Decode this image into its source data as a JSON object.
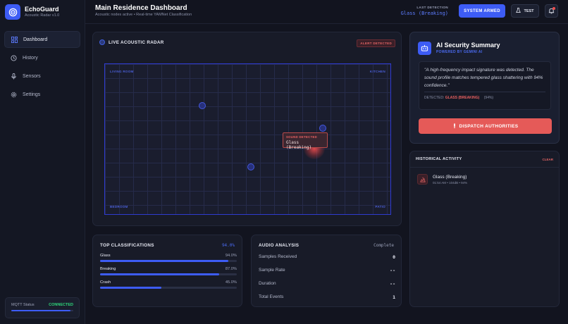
{
  "brand": {
    "name": "EchoGuard",
    "subtitle": "Acoustic Radar v1.0"
  },
  "nav": {
    "items": [
      {
        "label": "Dashboard",
        "icon": "grid-icon",
        "active": true
      },
      {
        "label": "History",
        "icon": "history-icon"
      },
      {
        "label": "Sensors",
        "icon": "microphone-icon"
      },
      {
        "label": "Settings",
        "icon": "gear-icon"
      }
    ]
  },
  "mqtt": {
    "label": "MQTT Status",
    "value": "CONNECTED"
  },
  "header": {
    "title": "Main Residence Dashboard",
    "subtitle": "Acoustic nodes active • Real-time YAMNet Classification",
    "last_detection_label": "LAST DETECTION",
    "last_detection_value": "Glass (Breaking)",
    "armed_label": "SYSTEM ARMED",
    "test_label": "TEST"
  },
  "radar": {
    "title": "LIVE ACOUSTIC RADAR",
    "alert": "ALERT DETECTED",
    "corners": {
      "top_left": "LIVING ROOM",
      "top_right": "KITCHEN",
      "bottom_left": "BEDROOM",
      "bottom_right": "PATIO"
    },
    "detection_label": "SOUND DETECTED",
    "detection_value": "Glass (Breaking)"
  },
  "classifications": {
    "title": "TOP CLASSIFICATIONS",
    "top_pct": "94.0%",
    "items": [
      {
        "name": "Glass",
        "value": "94.0%",
        "fraction": 0.94
      },
      {
        "name": "Breaking",
        "value": "87.0%",
        "fraction": 0.87
      },
      {
        "name": "Crash",
        "value": "45.0%",
        "fraction": 0.45
      }
    ]
  },
  "audio": {
    "title": "AUDIO ANALYSIS",
    "status": "Complete",
    "rows": [
      {
        "label": "Samples Received",
        "value": "0"
      },
      {
        "label": "Sample Rate",
        "value": "--"
      },
      {
        "label": "Duration",
        "value": "--"
      },
      {
        "label": "Total Events",
        "value": "1"
      }
    ]
  },
  "ai": {
    "title": "AI Security Summary",
    "subtitle": "POWERED BY GEMINI AI",
    "quote": "\"A high-frequency impact signature was detected. The sound profile matches tempered glass shattering with 94% confidence.\"",
    "detected_label": "DETECTED:",
    "detected_value": "GLASS (BREAKING)",
    "confidence": "(94%)",
    "dispatch_label": "DISPATCH AUTHORITIES"
  },
  "history": {
    "title": "HISTORICAL ACTIVITY",
    "clear_label": "CLEAR",
    "items": [
      {
        "name": "Glass (Breaking)",
        "meta": "01:54 AM • 104dB • 94%"
      }
    ]
  },
  "colors": {
    "accent": "#3d5cf5",
    "danger": "#e55a58",
    "success": "#2fd67b"
  }
}
